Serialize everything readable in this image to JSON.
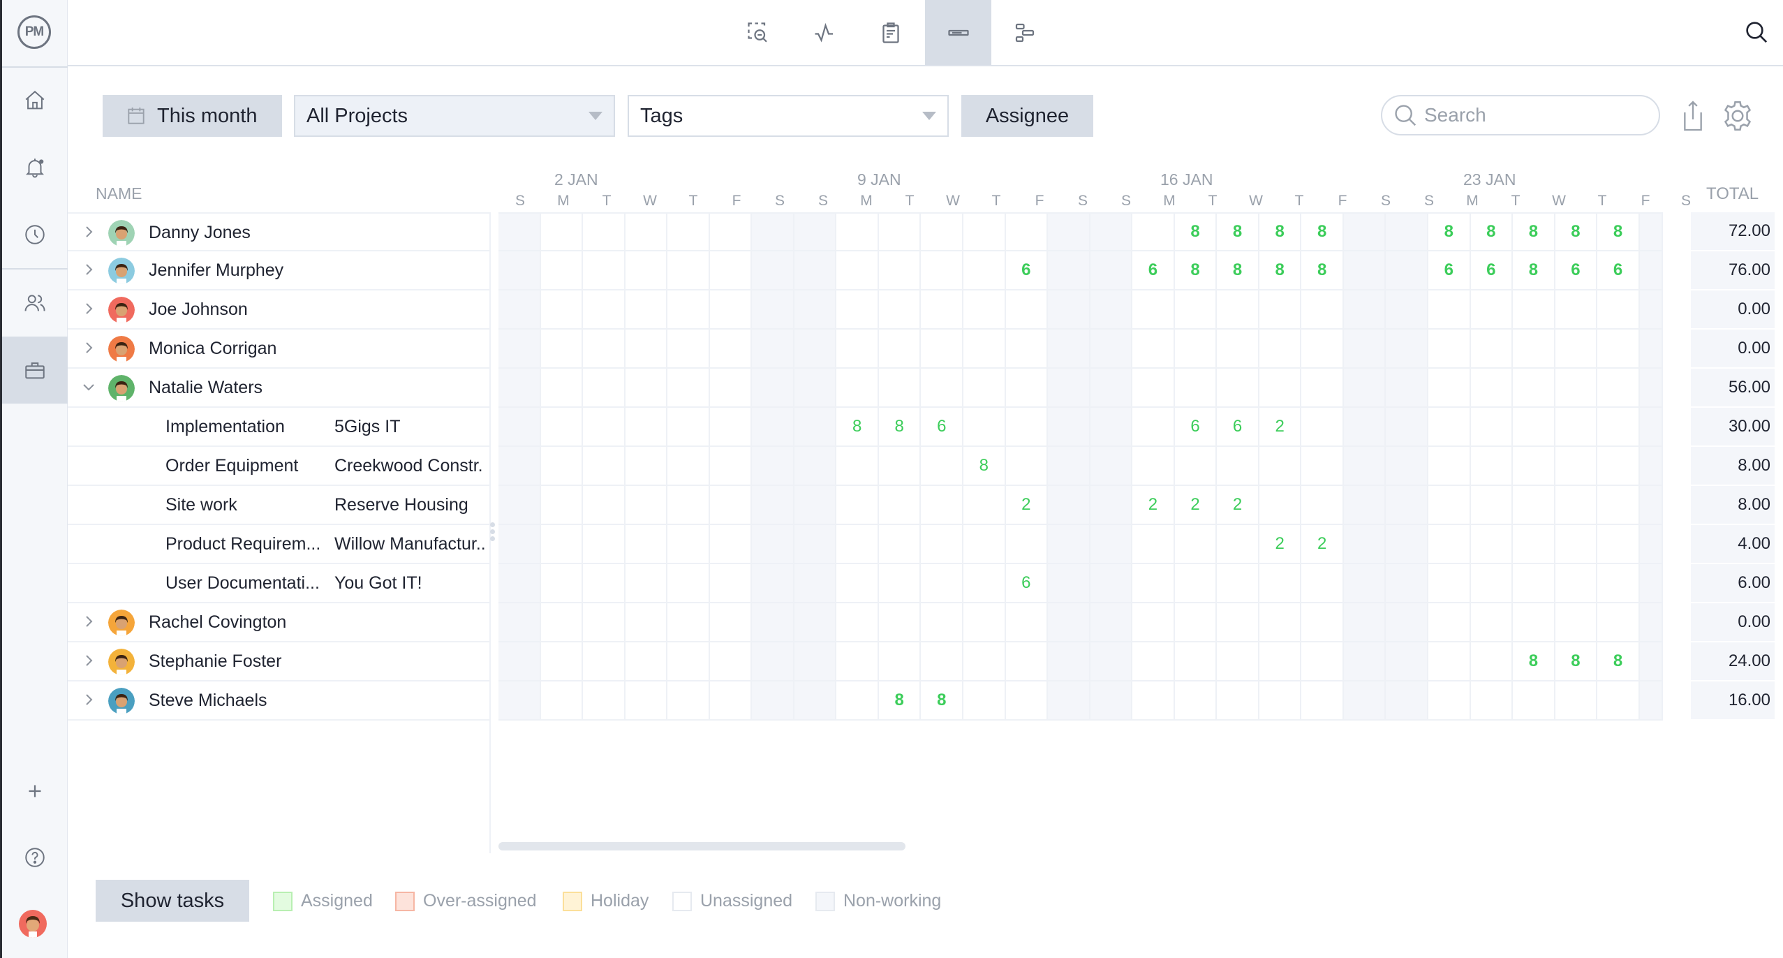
{
  "app": {
    "logo": "PM"
  },
  "sidebar": {
    "items": [
      {
        "name": "home",
        "icon": "home-icon",
        "active": false
      },
      {
        "name": "notifications",
        "icon": "bell-icon",
        "active": false
      },
      {
        "name": "timesheets",
        "icon": "clock-icon",
        "active": false
      },
      {
        "name": "team",
        "icon": "users-icon",
        "active": false
      },
      {
        "name": "projects",
        "icon": "briefcase-icon",
        "active": true
      }
    ],
    "bottom": [
      {
        "name": "add",
        "icon": "plus-icon"
      },
      {
        "name": "help",
        "icon": "help-icon"
      },
      {
        "name": "profile",
        "icon": "user-avatar"
      }
    ]
  },
  "topbar": {
    "views": [
      {
        "name": "zoom-view",
        "icon": "zoom-out-icon",
        "active": false
      },
      {
        "name": "dashboard-view",
        "icon": "pulse-icon",
        "active": false
      },
      {
        "name": "list-view",
        "icon": "clipboard-icon",
        "active": false
      },
      {
        "name": "workload-view",
        "icon": "workload-icon",
        "active": true
      },
      {
        "name": "gantt-view",
        "icon": "gantt-icon",
        "active": false
      }
    ],
    "search_icon": "search-icon"
  },
  "filters": {
    "date_range": "This month",
    "projects": "All Projects",
    "tags": "Tags",
    "group_by": "Assignee",
    "search_placeholder": "Search"
  },
  "grid": {
    "name_header": "NAME",
    "total_header": "TOTAL",
    "weeks": [
      {
        "label": "2 JAN",
        "col": 1
      },
      {
        "label": "9 JAN",
        "col": 8
      },
      {
        "label": "16 JAN",
        "col": 15
      },
      {
        "label": "23 JAN",
        "col": 22
      }
    ],
    "days": [
      "S",
      "M",
      "T",
      "W",
      "T",
      "F",
      "S",
      "S",
      "M",
      "T",
      "W",
      "T",
      "F",
      "S",
      "S",
      "M",
      "T",
      "W",
      "T",
      "F",
      "S",
      "S",
      "M",
      "T",
      "W",
      "T",
      "F",
      "S"
    ],
    "non_working_cols": [
      0,
      6,
      7,
      13,
      14,
      20,
      21,
      27
    ],
    "rows": [
      {
        "type": "person",
        "name": "Danny Jones",
        "expanded": false,
        "avatar_bg": "#9fd3b4",
        "total": "72.00",
        "hours": {
          "16": "8",
          "17": "8",
          "18": "8",
          "19": "8",
          "22": "8",
          "23": "8",
          "24": "8",
          "25": "8",
          "26": "8"
        }
      },
      {
        "type": "person",
        "name": "Jennifer Murphey",
        "expanded": false,
        "avatar_bg": "#8ccbe0",
        "total": "76.00",
        "hours": {
          "12": "6",
          "15": "6",
          "16": "8",
          "17": "8",
          "18": "8",
          "19": "8",
          "22": "6",
          "23": "6",
          "24": "8",
          "25": "6",
          "26": "6"
        }
      },
      {
        "type": "person",
        "name": "Joe Johnson",
        "expanded": false,
        "avatar_bg": "#f06a5e",
        "total": "0.00",
        "hours": {}
      },
      {
        "type": "person",
        "name": "Monica Corrigan",
        "expanded": false,
        "avatar_bg": "#ef7a45",
        "total": "0.00",
        "hours": {}
      },
      {
        "type": "person",
        "name": "Natalie Waters",
        "expanded": true,
        "avatar_bg": "#5fb36a",
        "total": "56.00",
        "hours": {}
      },
      {
        "type": "task",
        "name": "Implementation",
        "project": "5Gigs IT",
        "total": "30.00",
        "hours": {
          "8": "8",
          "9": "8",
          "10": "6",
          "16": "6",
          "17": "6",
          "18": "2"
        }
      },
      {
        "type": "task",
        "name": "Order Equipment",
        "project": "Creekwood Constr.",
        "total": "8.00",
        "hours": {
          "11": "8"
        }
      },
      {
        "type": "task",
        "name": "Site work",
        "project": "Reserve Housing",
        "total": "8.00",
        "hours": {
          "12": "2",
          "15": "2",
          "16": "2",
          "17": "2"
        }
      },
      {
        "type": "task",
        "name": "Product Requirem...",
        "project": "Willow Manufactur..",
        "total": "4.00",
        "hours": {
          "18": "2",
          "19": "2"
        }
      },
      {
        "type": "task",
        "name": "User Documentati...",
        "project": "You Got IT!",
        "total": "6.00",
        "hours": {
          "12": "6"
        }
      },
      {
        "type": "person",
        "name": "Rachel Covington",
        "expanded": false,
        "avatar_bg": "#f5a53a",
        "total": "0.00",
        "hours": {}
      },
      {
        "type": "person",
        "name": "Stephanie Foster",
        "expanded": false,
        "avatar_bg": "#f3b23a",
        "total": "24.00",
        "hours": {
          "24": "8",
          "25": "8",
          "26": "8"
        }
      },
      {
        "type": "person",
        "name": "Steve Michaels",
        "expanded": false,
        "avatar_bg": "#4a9fc0",
        "total": "16.00",
        "hours": {
          "9": "8",
          "10": "8"
        }
      }
    ]
  },
  "footer": {
    "show_tasks": "Show tasks",
    "legend": [
      {
        "label": "Assigned",
        "fill": "#e3fbe0",
        "border": "#b8efb2"
      },
      {
        "label": "Over-assigned",
        "fill": "#fde3db",
        "border": "#f6b6a4"
      },
      {
        "label": "Holiday",
        "fill": "#fff3d6",
        "border": "#fbdf9a"
      },
      {
        "label": "Unassigned",
        "fill": "#ffffff",
        "border": "#e6eaf0"
      },
      {
        "label": "Non-working",
        "fill": "#f4f6fa",
        "border": "#e6eaf0"
      }
    ]
  },
  "colors": {
    "accent_green": "#3ccd5a",
    "active_bg": "#d7dde6"
  }
}
